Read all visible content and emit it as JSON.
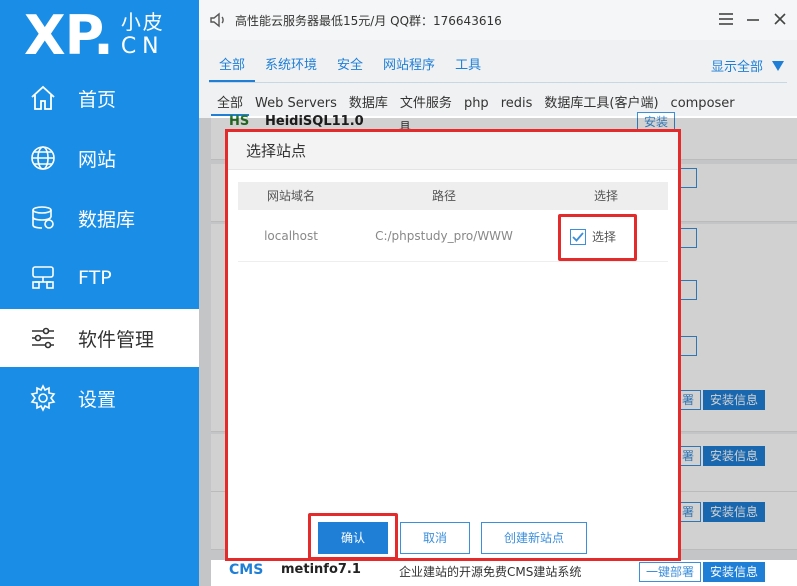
{
  "logo": {
    "main": "XP",
    "dot": ".",
    "top": "小皮",
    "bottom": "CN"
  },
  "sidebar": {
    "items": [
      {
        "label": "首页",
        "icon": "home-icon"
      },
      {
        "label": "网站",
        "icon": "globe-icon"
      },
      {
        "label": "数据库",
        "icon": "database-icon"
      },
      {
        "label": "FTP",
        "icon": "ftp-server-icon"
      },
      {
        "label": "软件管理",
        "icon": "sliders-icon",
        "active": true
      },
      {
        "label": "设置",
        "icon": "gear-icon"
      }
    ]
  },
  "topbar": {
    "ad": "高性能云服务器最低15元/月  QQ群：176643616"
  },
  "categories": {
    "tabs": [
      "全部",
      "系统环境",
      "安全",
      "网站程序",
      "工具"
    ],
    "show_all": "显示全部"
  },
  "subtabs": [
    "全部",
    "Web Servers",
    "数据库",
    "文件服务",
    "php",
    "redis",
    "数据库工具(客户端)",
    "composer"
  ],
  "background_list": {
    "heidisql": "HeidiSQL11.0",
    "hs_logo": "HS",
    "install": "安装",
    "deploy": "一键部署",
    "deploy_partial": "署",
    "info": "安装信息",
    "cms_logo": "CMS",
    "metinfo": "metinfo7.1",
    "metinfo_desc": "企业建站的开源免费CMS建站系统",
    "desc_partial": "具"
  },
  "dialog": {
    "title": "选择站点",
    "headers": [
      "网站域名",
      "路径",
      "选择"
    ],
    "rows": [
      {
        "domain": "localhost",
        "path": "C:/phpstudy_pro/WWW",
        "select_label": "选择",
        "checked": true
      }
    ],
    "buttons": {
      "ok": "确认",
      "cancel": "取消",
      "new_site": "创建新站点"
    }
  },
  "colors": {
    "sidebar": "#1a8ee6",
    "accent": "#1f7fd6",
    "highlight": "#e32b2b"
  }
}
